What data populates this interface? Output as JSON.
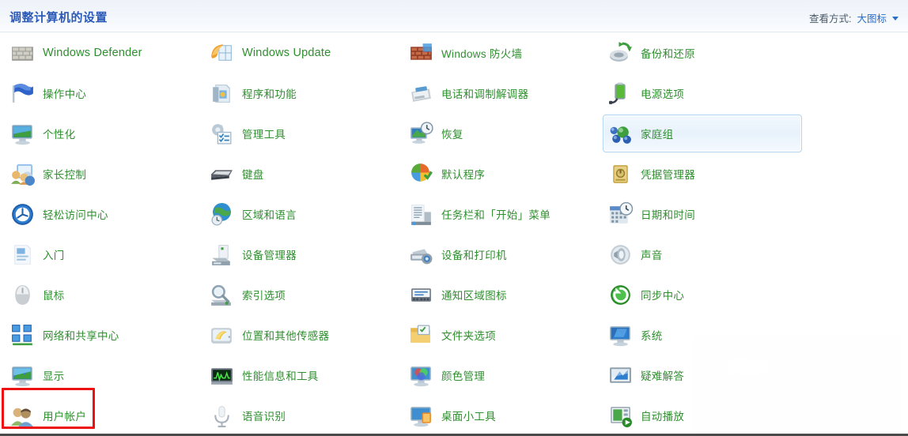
{
  "header": {
    "title": "调整计算机的设置",
    "view_by_label": "查看方式:",
    "view_by_value": "大图标",
    "dropdown_icon": "chevron-down-icon"
  },
  "colors": {
    "header_title": "#2b5ab8",
    "item_label": "#2f8f2f",
    "link_blue": "#2a6ec9",
    "highlight_border": "#b3d4f0",
    "annotation_red": "#ee1111",
    "background": "#ffffff"
  },
  "grid": {
    "columns": 4,
    "rows": 10,
    "items": [
      {
        "label": "Windows Defender",
        "icon": "windows-defender-icon",
        "latin": true,
        "col": 0,
        "row": 0,
        "state": "normal"
      },
      {
        "label": "操作中心",
        "icon": "action-center-flag-icon",
        "latin": false,
        "col": 0,
        "row": 1,
        "state": "normal"
      },
      {
        "label": "个性化",
        "icon": "personalization-icon",
        "latin": false,
        "col": 0,
        "row": 2,
        "state": "normal"
      },
      {
        "label": "家长控制",
        "icon": "parental-controls-icon",
        "latin": false,
        "col": 0,
        "row": 3,
        "state": "normal"
      },
      {
        "label": "轻松访问中心",
        "icon": "ease-of-access-icon",
        "latin": false,
        "col": 0,
        "row": 4,
        "state": "normal"
      },
      {
        "label": "入门",
        "icon": "getting-started-icon",
        "latin": false,
        "col": 0,
        "row": 5,
        "state": "normal"
      },
      {
        "label": "鼠标",
        "icon": "mouse-icon",
        "latin": false,
        "col": 0,
        "row": 6,
        "state": "normal"
      },
      {
        "label": "网络和共享中心",
        "icon": "network-sharing-icon",
        "latin": false,
        "col": 0,
        "row": 7,
        "state": "normal"
      },
      {
        "label": "显示",
        "icon": "display-icon",
        "latin": false,
        "col": 0,
        "row": 8,
        "state": "normal"
      },
      {
        "label": "用户帐户",
        "icon": "user-accounts-icon",
        "latin": false,
        "col": 0,
        "row": 9,
        "state": "annotated"
      },
      {
        "label": "Windows Update",
        "icon": "windows-update-icon",
        "latin": true,
        "col": 1,
        "row": 0,
        "state": "normal"
      },
      {
        "label": "程序和功能",
        "icon": "programs-features-icon",
        "latin": false,
        "col": 1,
        "row": 1,
        "state": "normal"
      },
      {
        "label": "管理工具",
        "icon": "admin-tools-icon",
        "latin": false,
        "col": 1,
        "row": 2,
        "state": "normal"
      },
      {
        "label": "键盘",
        "icon": "keyboard-icon",
        "latin": false,
        "col": 1,
        "row": 3,
        "state": "normal"
      },
      {
        "label": "区域和语言",
        "icon": "region-language-icon",
        "latin": false,
        "col": 1,
        "row": 4,
        "state": "normal"
      },
      {
        "label": "设备管理器",
        "icon": "device-manager-icon",
        "latin": false,
        "col": 1,
        "row": 5,
        "state": "normal"
      },
      {
        "label": "索引选项",
        "icon": "indexing-options-icon",
        "latin": false,
        "col": 1,
        "row": 6,
        "state": "normal"
      },
      {
        "label": "位置和其他传感器",
        "icon": "location-sensors-icon",
        "latin": false,
        "col": 1,
        "row": 7,
        "state": "normal"
      },
      {
        "label": "性能信息和工具",
        "icon": "performance-info-icon",
        "latin": false,
        "col": 1,
        "row": 8,
        "state": "normal"
      },
      {
        "label": "语音识别",
        "icon": "speech-recognition-icon",
        "latin": false,
        "col": 1,
        "row": 9,
        "state": "normal"
      },
      {
        "label": "Windows 防火墙",
        "icon": "firewall-icon",
        "latin": false,
        "col": 2,
        "row": 0,
        "state": "normal"
      },
      {
        "label": "电话和调制解调器",
        "icon": "phone-modem-icon",
        "latin": false,
        "col": 2,
        "row": 1,
        "state": "normal"
      },
      {
        "label": "恢复",
        "icon": "recovery-icon",
        "latin": false,
        "col": 2,
        "row": 2,
        "state": "normal"
      },
      {
        "label": "默认程序",
        "icon": "default-programs-icon",
        "latin": false,
        "col": 2,
        "row": 3,
        "state": "normal"
      },
      {
        "label": "任务栏和「开始」菜单",
        "icon": "taskbar-startmenu-icon",
        "latin": false,
        "col": 2,
        "row": 4,
        "state": "normal"
      },
      {
        "label": "设备和打印机",
        "icon": "devices-printers-icon",
        "latin": false,
        "col": 2,
        "row": 5,
        "state": "normal"
      },
      {
        "label": "通知区域图标",
        "icon": "notification-area-icon",
        "latin": false,
        "col": 2,
        "row": 6,
        "state": "normal"
      },
      {
        "label": "文件夹选项",
        "icon": "folder-options-icon",
        "latin": false,
        "col": 2,
        "row": 7,
        "state": "normal"
      },
      {
        "label": "颜色管理",
        "icon": "color-management-icon",
        "latin": false,
        "col": 2,
        "row": 8,
        "state": "normal"
      },
      {
        "label": "桌面小工具",
        "icon": "desktop-gadgets-icon",
        "latin": false,
        "col": 2,
        "row": 9,
        "state": "normal"
      },
      {
        "label": "备份和还原",
        "icon": "backup-restore-icon",
        "latin": false,
        "col": 3,
        "row": 0,
        "state": "normal"
      },
      {
        "label": "电源选项",
        "icon": "power-options-icon",
        "latin": false,
        "col": 3,
        "row": 1,
        "state": "normal"
      },
      {
        "label": "家庭组",
        "icon": "homegroup-icon",
        "latin": false,
        "col": 3,
        "row": 2,
        "state": "hovered"
      },
      {
        "label": "凭据管理器",
        "icon": "credential-manager-icon",
        "latin": false,
        "col": 3,
        "row": 3,
        "state": "normal"
      },
      {
        "label": "日期和时间",
        "icon": "date-time-icon",
        "latin": false,
        "col": 3,
        "row": 4,
        "state": "normal"
      },
      {
        "label": "声音",
        "icon": "sound-icon",
        "latin": false,
        "col": 3,
        "row": 5,
        "state": "normal"
      },
      {
        "label": "同步中心",
        "icon": "sync-center-icon",
        "latin": false,
        "col": 3,
        "row": 6,
        "state": "normal"
      },
      {
        "label": "系统",
        "icon": "system-icon",
        "latin": false,
        "col": 3,
        "row": 7,
        "state": "normal"
      },
      {
        "label": "疑难解答",
        "icon": "troubleshooting-icon",
        "latin": false,
        "col": 3,
        "row": 8,
        "state": "obscured"
      },
      {
        "label": "自动播放",
        "icon": "autoplay-icon",
        "latin": false,
        "col": 3,
        "row": 9,
        "state": "obscured"
      }
    ]
  },
  "annotations": {
    "red_box_target": "用户帐户",
    "censor_overlay": "blurred-white-region"
  }
}
